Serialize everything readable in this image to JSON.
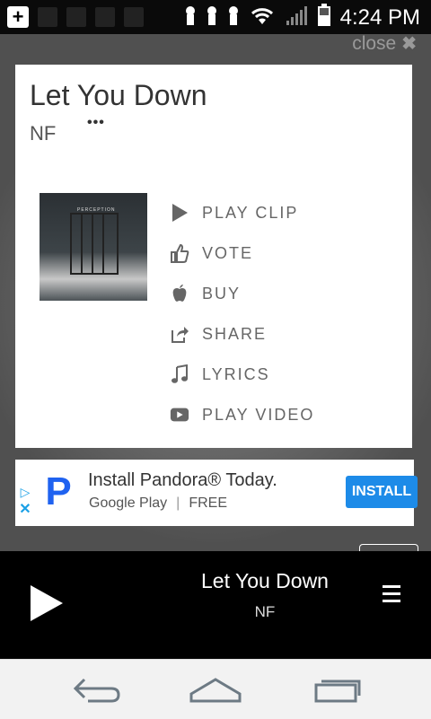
{
  "status_bar": {
    "time": "4:24 PM",
    "icons": [
      "add-icon",
      "notification-icon",
      "notification-icon",
      "notification-icon",
      "keyhole-icon",
      "keyhole-icon",
      "keyhole-icon",
      "wifi-icon",
      "signal-icon",
      "battery-icon"
    ]
  },
  "modal": {
    "close_label": "close",
    "song_title": "Let You Down",
    "artist": "NF",
    "more": "•••",
    "album_art_caption": "PERCEPTION",
    "actions": [
      {
        "label": "PLAY CLIP",
        "icon": "play-icon"
      },
      {
        "label": "VOTE",
        "icon": "thumbs-up-icon"
      },
      {
        "label": "BUY",
        "icon": "apple-icon"
      },
      {
        "label": "SHARE",
        "icon": "share-icon"
      },
      {
        "label": "LYRICS",
        "icon": "music-note-icon"
      },
      {
        "label": "PLAY VIDEO",
        "icon": "video-play-icon"
      }
    ]
  },
  "ad": {
    "title": "Install Pandora® Today.",
    "store": "Google Play",
    "separator": "|",
    "price": "FREE",
    "install_label": "INSTALL",
    "logo_letter": "P",
    "adchoices_icon": "adchoices-icon",
    "close_icon": "close-ad-icon",
    "accent": "#1d8be8"
  },
  "player": {
    "title": "Let You Down",
    "artist": "NF"
  },
  "navbar": {
    "buttons": [
      "back-icon",
      "home-icon",
      "recents-icon"
    ]
  }
}
